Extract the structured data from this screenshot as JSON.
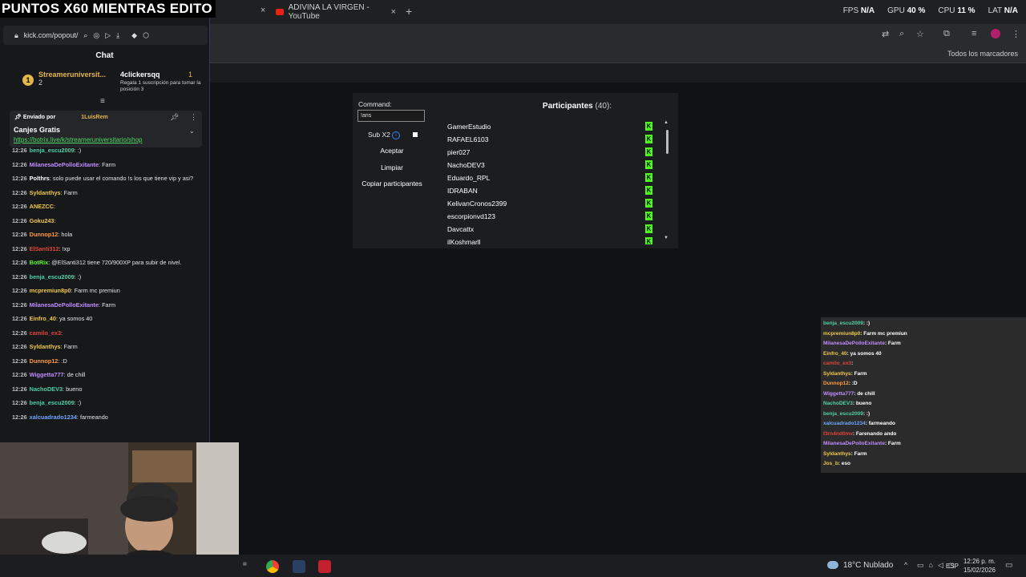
{
  "overlay_title": "PUNTOS X60 MIENTRAS EDITO",
  "browser": {
    "tabs": [
      {
        "title": "ADIVINA LA VIRGEN - YouTube",
        "close": "×"
      }
    ],
    "new_tab": "+",
    "close_first": "×",
    "perf": [
      {
        "label": "FPS",
        "value": "N/A"
      },
      {
        "label": "GPU",
        "value": "40 %"
      },
      {
        "label": "CPU",
        "value": "11 %"
      },
      {
        "label": "LAT",
        "value": "N/A"
      }
    ],
    "bookmarks_all": "Todos los marcadores"
  },
  "popout": {
    "url": "kick.com/popout/",
    "chat_heading": "Chat",
    "leaderboard": [
      {
        "name": "Streameruniversit...",
        "count": "2"
      },
      {
        "name": "4clickersqq",
        "count": "1",
        "sub": "Regala 1 suscripción para tomar la posición 3"
      }
    ],
    "pinned": {
      "sent_by_label": "Enviado por",
      "sent_by_user": "1LuisRem",
      "title": "Canjes Gratis",
      "link": "https://botrix.live/k/streameruniversitario/shop"
    }
  },
  "chat_messages": [
    {
      "time": "12:26",
      "user": "benja_escu2009",
      "color": "#4fd1a5",
      "text": ": :)"
    },
    {
      "time": "12:26",
      "user": "MilanesaDePolloExitante",
      "color": "#c18cff",
      "text": ": Farm"
    },
    {
      "time": "12:26",
      "user": "Polthrs",
      "color": "#ffffff",
      "text": ": solo puede usar el comando !s los que tiene vip y asi?"
    },
    {
      "time": "12:26",
      "user": "Syldanthys",
      "color": "#f0c84a",
      "text": ": Farm"
    },
    {
      "time": "12:26",
      "user": "ANEZCC",
      "color": "#f0c84a",
      "text": ":"
    },
    {
      "time": "12:26",
      "user": "Goku243",
      "color": "#f0c84a",
      "text": ":"
    },
    {
      "time": "12:26",
      "user": "Dunnop12",
      "color": "#ff9a3d",
      "text": ": hola"
    },
    {
      "time": "12:26",
      "user": "ElSanti312",
      "color": "#e2443a",
      "text": ": !xp"
    },
    {
      "time": "12:26",
      "user": "BotRix",
      "color": "#53fc18",
      "text": ": @ElSanti312 tiene 720/900XP para subir de nivel."
    },
    {
      "time": "12:26",
      "user": "benja_escu2009",
      "color": "#4fd1a5",
      "text": ": :)"
    },
    {
      "time": "12:26",
      "user": "mcpremiun8p0",
      "color": "#f0c84a",
      "text": ": Farm mc premiun"
    },
    {
      "time": "12:26",
      "user": "MilanesaDePolloExitante",
      "color": "#c18cff",
      "text": ": Farm"
    },
    {
      "time": "12:26",
      "user": "Einfro_40",
      "color": "#f0c84a",
      "text": ": ya somos 40"
    },
    {
      "time": "12:26",
      "user": "camilo_ex3",
      "color": "#e2443a",
      "text": ":"
    },
    {
      "time": "12:26",
      "user": "Syldanthys",
      "color": "#f0c84a",
      "text": ": Farm"
    },
    {
      "time": "12:26",
      "user": "Dunnop12",
      "color": "#ff9a3d",
      "text": ": :D"
    },
    {
      "time": "12:26",
      "user": "Wiggetta777",
      "color": "#c18cff",
      "text": ": de chill"
    },
    {
      "time": "12:26",
      "user": "NachoDEV3",
      "color": "#4fd1a5",
      "text": ": bueno"
    },
    {
      "time": "12:26",
      "user": "benja_escu2009",
      "color": "#4fd1a5",
      "text": ": :)"
    },
    {
      "time": "12:26",
      "user": "xalcuadrado1234",
      "color": "#6fa8ff",
      "text": ": farmeando"
    }
  ],
  "panel": {
    "command_label": "Command:",
    "command_value": "!aris",
    "sub_label": "Sub X2",
    "buttons": {
      "accept": "Aceptar",
      "clear": "Limpiar",
      "copy": "Copiar participantes"
    },
    "participants_title": "Participantes",
    "participants_count": "(40):",
    "participants": [
      "GamerEstudio",
      "RAFAEL6103",
      "pier027",
      "NachoDEV3",
      "Eduardo_RPL",
      "IDRABAN",
      "KelivanCronos2399",
      "escorpionvd123",
      "Davcattx",
      "ilKoshmarll"
    ],
    "kick_badge": "K"
  },
  "overlay_chat": [
    {
      "user": "benja_escu2009",
      "color": "#4fd1a5",
      "text": ": :)"
    },
    {
      "user": "mcpremiun8p0",
      "color": "#f0c84a",
      "text": ": Farm mc premiun"
    },
    {
      "user": "MilanesaDePolloExitante",
      "color": "#c18cff",
      "text": ": Farm"
    },
    {
      "user": "Einfro_40",
      "color": "#f0c84a",
      "text": ": ya somos 40"
    },
    {
      "user": "camilo_ex3",
      "color": "#e2443a",
      "text": ":"
    },
    {
      "user": "Syldanthys",
      "color": "#f0c84a",
      "text": ": Farm"
    },
    {
      "user": "Dunnop12",
      "color": "#ff9a3d",
      "text": ": :D"
    },
    {
      "user": "Wiggetta777",
      "color": "#c18cff",
      "text": ": de chill"
    },
    {
      "user": "NachoDEV3",
      "color": "#4fd1a5",
      "text": ": bueno"
    },
    {
      "user": "benja_escu2009",
      "color": "#4fd1a5",
      "text": ": :)"
    },
    {
      "user": "xalcuadrado1234",
      "color": "#6fa8ff",
      "text": ": farmeando"
    },
    {
      "user": "f3rn4nd0mv",
      "color": "#e2443a",
      "text": ": Farenando ando"
    },
    {
      "user": "MilanesaDePolloExitante",
      "color": "#c18cff",
      "text": ": Farm"
    },
    {
      "user": "Syldanthys",
      "color": "#f0c84a",
      "text": ": Farm"
    },
    {
      "user": "Jos_b",
      "color": "#f0c84a",
      "text": ": eso"
    }
  ],
  "taskbar": {
    "weather": "18°C  Nublado",
    "lang": "ESP",
    "time": "12:26 p. m.",
    "date": "15/02/2026"
  },
  "colors": {
    "kick_green": "#53fc18",
    "accent_blue": "#2c3a6b"
  }
}
